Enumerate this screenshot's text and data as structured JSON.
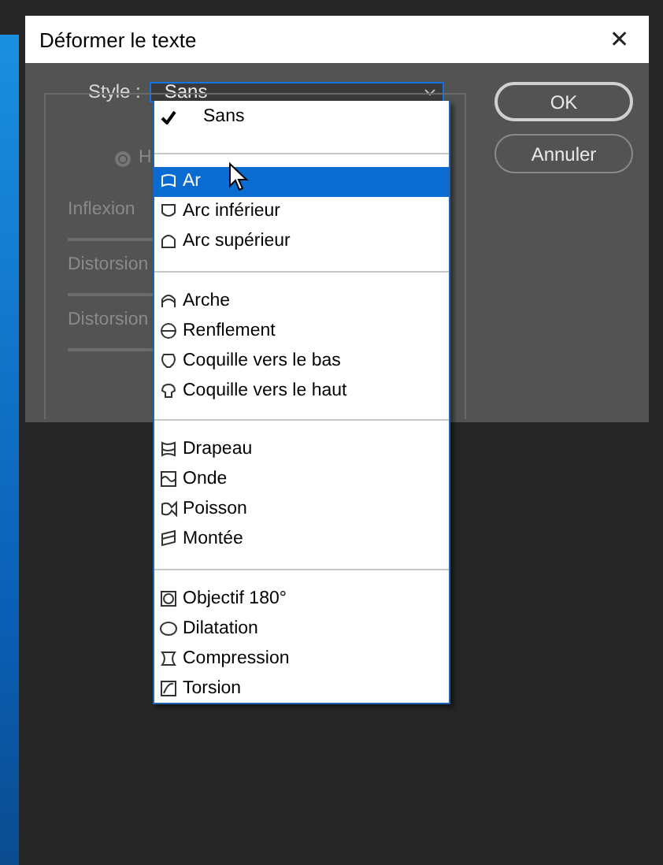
{
  "window": {
    "title": "Déformer le texte",
    "close": "✕"
  },
  "style": {
    "label": "Style :",
    "value": "Sans"
  },
  "radio": {
    "label": "H",
    "selected": true,
    "disabled": true
  },
  "sliders": [
    {
      "label": "Inflexion",
      "disabled": true
    },
    {
      "label": "Distorsion",
      "disabled": true
    },
    {
      "label": "Distorsion",
      "disabled": true
    }
  ],
  "buttons": [
    {
      "label": "OK",
      "kind": "primary"
    },
    {
      "label": "Annuler",
      "kind": "secondary"
    }
  ],
  "menu": {
    "groups": [
      {
        "items": [
          {
            "label": "Sans",
            "checked": true,
            "selected": false
          }
        ]
      },
      {
        "items": [
          {
            "label": "Ar",
            "selected": true
          },
          {
            "label": "Arc inférieur",
            "selected": false
          },
          {
            "label": "Arc supérieur",
            "selected": false
          }
        ]
      },
      {
        "items": [
          {
            "label": "Arche",
            "selected": false
          },
          {
            "label": "Renflement",
            "selected": false
          },
          {
            "label": "Coquille vers le bas",
            "selected": false
          },
          {
            "label": "Coquille vers le haut",
            "selected": false
          }
        ]
      },
      {
        "items": [
          {
            "label": "Drapeau",
            "selected": false
          },
          {
            "label": "Onde",
            "selected": false
          },
          {
            "label": "Poisson",
            "selected": false
          },
          {
            "label": "Montée",
            "selected": false
          }
        ]
      },
      {
        "items": [
          {
            "label": "Objectif 180°",
            "selected": false
          },
          {
            "label": "Dilatation",
            "selected": false
          },
          {
            "label": "Compression",
            "selected": false
          },
          {
            "label": "Torsion",
            "selected": false
          }
        ]
      }
    ]
  }
}
